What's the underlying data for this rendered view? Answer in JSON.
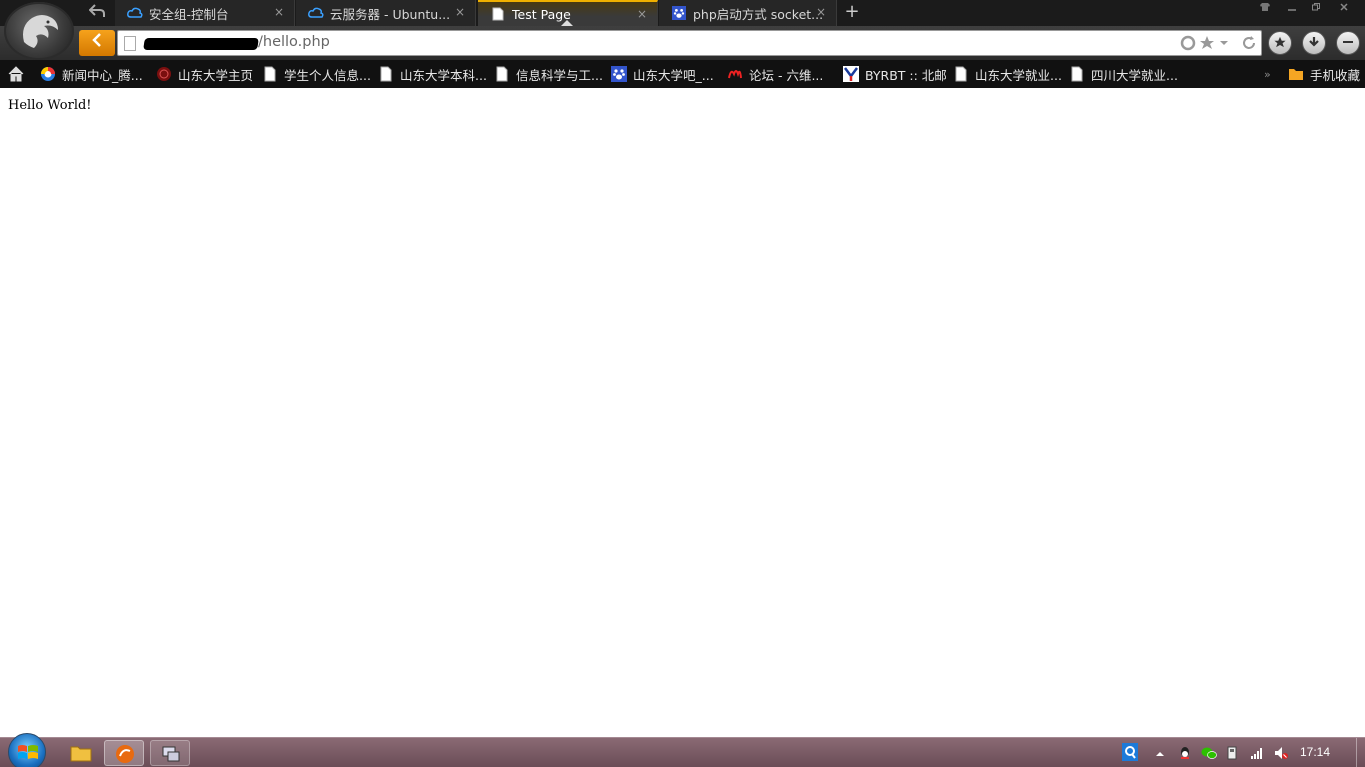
{
  "tabs": [
    {
      "title": "安全组-控制台",
      "icon": "cloud-icon",
      "active": false
    },
    {
      "title": "云服务器 - Ubuntu...",
      "icon": "cloud-icon",
      "active": false
    },
    {
      "title": "Test Page",
      "icon": "page-icon",
      "active": true
    },
    {
      "title": "php启动方式 socket...",
      "icon": "paw-icon",
      "active": false
    }
  ],
  "tab_close_glyph": "×",
  "new_tab_glyph": "+",
  "address": {
    "url_visible": "/hello.php"
  },
  "bookmarks": [
    {
      "label": "新闻中心_腾..."
    },
    {
      "label": "山东大学主页"
    },
    {
      "label": "学生个人信息..."
    },
    {
      "label": "山东大学本科..."
    },
    {
      "label": "信息科学与工..."
    },
    {
      "label": "山东大学吧_..."
    },
    {
      "label": "论坛 - 六维..."
    },
    {
      "label": "BYRBT :: 北邮"
    },
    {
      "label": "山东大学就业..."
    },
    {
      "label": "四川大学就业..."
    }
  ],
  "bookmark_overflow": "»",
  "bookmark_folder": "手机收藏",
  "page": {
    "body_text": "Hello World!"
  },
  "taskbar": {
    "clock": "17:14"
  },
  "colors": {
    "accent": "#f0b000",
    "back_button": "#e88a0c",
    "tab_bg": "#262626",
    "bookmark_bar": "#111111",
    "taskbar": "#7a5c66"
  }
}
